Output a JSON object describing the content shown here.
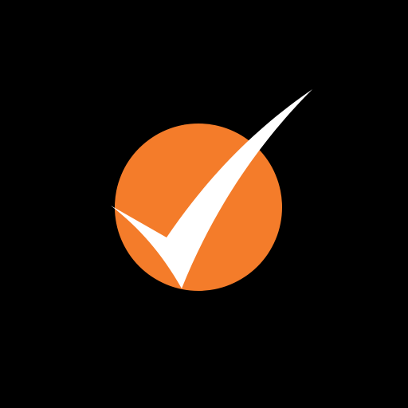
{
  "icon": {
    "name": "orange-circle-checkmark-logo",
    "colors": {
      "background": "#000000",
      "circle": "#F47C2A",
      "checkmark": "#FFFFFF"
    }
  }
}
